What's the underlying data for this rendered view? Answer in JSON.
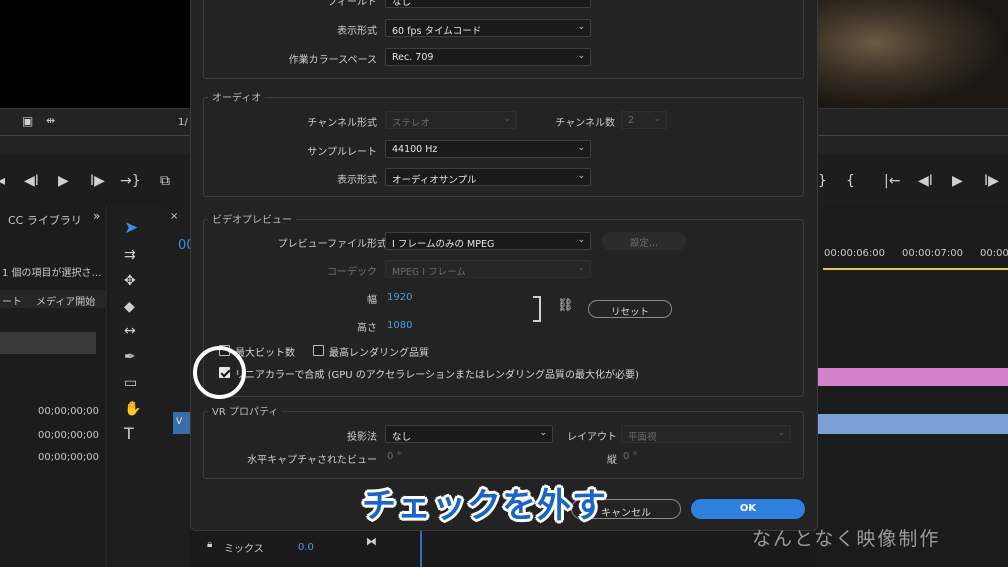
{
  "background": {
    "left": {
      "ruler_value": "1/",
      "panel_tab": "CC ライブラリ",
      "selection_info": "1 個の項目が選択さ…",
      "col_headers": [
        "ート",
        "メディア開始"
      ],
      "timecodes": [
        "00;00;00;00",
        "00;00;00;00",
        "00;00;00;00"
      ],
      "timecode_prefix": "00",
      "track_label": "ミックス",
      "track_value": "0.0",
      "clip_label": "V"
    },
    "right": {
      "timecodes": [
        "00:00:06:00",
        "00:00:07:00",
        "00:00"
      ]
    }
  },
  "dialog": {
    "video_section": {
      "field_label": "フィールド",
      "field_value": "なし",
      "display_format_label": "表示形式",
      "display_format_value": "60 fps タイムコード",
      "color_space_label": "作業カラースペース",
      "color_space_value": "Rec. 709"
    },
    "audio_section": {
      "title": "オーディオ",
      "channel_format_label": "チャンネル形式",
      "channel_format_value": "ステレオ",
      "channel_count_label": "チャンネル数",
      "channel_count_value": "2",
      "sample_rate_label": "サンプルレート",
      "sample_rate_value": "44100 Hz",
      "display_format_label": "表示形式",
      "display_format_value": "オーディオサンプル"
    },
    "preview_section": {
      "title": "ビデオプレビュー",
      "file_format_label": "プレビューファイル形式",
      "file_format_value": "I フレームのみの MPEG",
      "settings_button": "設定...",
      "codec_label": "コーデック",
      "codec_value": "MPEG I フレーム",
      "width_label": "幅",
      "width_value": "1920",
      "height_label": "高さ",
      "height_value": "1080",
      "reset_button": "リセット",
      "max_bit_depth": "最大ビット数",
      "max_render_quality": "最高レンダリング品質",
      "linear_color": "リニアカラーで合成 (GPU のアクセラレーションまたはレンダリング品質の最大化が必要)"
    },
    "vr_section": {
      "title": "VR プロパティ",
      "projection_label": "投影法",
      "projection_value": "なし",
      "layout_label": "レイアウト",
      "layout_value": "平面視",
      "h_view_label": "水平キャプチャされたビュー",
      "h_view_value": "0 °",
      "v_label": "縦",
      "v_value": "0 °"
    },
    "cancel_label": "キャンセル",
    "ok_label": "OK"
  },
  "caption": "チェックを外す",
  "watermark": "なんとなく映像制作"
}
